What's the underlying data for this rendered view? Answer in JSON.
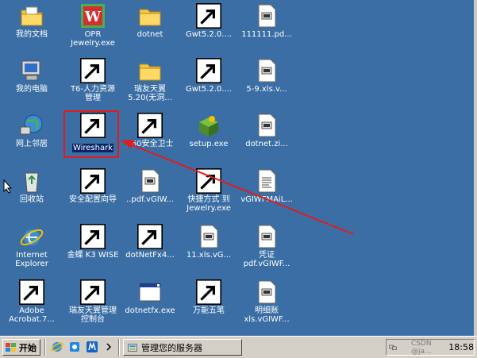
{
  "desktop": {
    "icons": [
      {
        "label": "我的文档",
        "icon": "my-documents-icon"
      },
      {
        "label": "OPR\nJewelry.exe",
        "icon": "wps-app-icon"
      },
      {
        "label": "dotnet",
        "icon": "folder-icon"
      },
      {
        "label": "Gwt5.2.0....",
        "icon": "installer-icon"
      },
      {
        "label": "111111.pd...",
        "icon": "document-icon"
      },
      {
        "label": "我的电脑",
        "icon": "my-computer-icon"
      },
      {
        "label": "T6-人力资源\n管理",
        "icon": "hr-app-icon"
      },
      {
        "label": "瑞友天翼\n5.20(无洞...",
        "icon": "folder-icon"
      },
      {
        "label": "Gwt5.2.0....",
        "icon": "installer-icon"
      },
      {
        "label": "5-9.xls.v...",
        "icon": "document-icon"
      },
      {
        "label": "网上邻居",
        "icon": "network-places-icon"
      },
      {
        "label": "Wireshark",
        "icon": "wireshark-shark-fin-icon"
      },
      {
        "label": "360安全卫士",
        "icon": "program-window-icon"
      },
      {
        "label": "setup.exe",
        "icon": "setup-box-icon"
      },
      {
        "label": "dotnet.zi...",
        "icon": "document-icon"
      },
      {
        "label": "回收站",
        "icon": "recycle-bin-icon"
      },
      {
        "label": "安全配置向导",
        "icon": "security-wizard-icon"
      },
      {
        "label": "..pdf.vGIW...",
        "icon": "document-icon"
      },
      {
        "label": "快捷方式 到\nJewelry.exe",
        "icon": "wps-app-icon"
      },
      {
        "label": "vGIWFMAiL...",
        "icon": "text-file-icon"
      },
      {
        "label": "Internet\nExplorer",
        "icon": "internet-explorer-icon"
      },
      {
        "label": "金蝶 K3 WISE",
        "icon": "kingdee-k3-icon"
      },
      {
        "label": "dotNetFx4...",
        "icon": "installer-icon"
      },
      {
        "label": "11.xls.vG...",
        "icon": "document-icon"
      },
      {
        "label": "凭证\npdf.vGIWF...",
        "icon": "document-icon"
      },
      {
        "label": "Adobe\nAcrobat.7...",
        "icon": "adobe-acrobat-icon"
      },
      {
        "label": "瑞友天翼管理\n控制台",
        "icon": "purple-orb-icon"
      },
      {
        "label": "dotnetfx.exe",
        "icon": "program-window-icon"
      },
      {
        "label": "万能五笔",
        "icon": "wanneng-wubi-icon"
      },
      {
        "label": "明细账\nxls.vGIWF...",
        "icon": "document-icon"
      }
    ]
  },
  "taskbar": {
    "start_label": "开始",
    "task_label": "管理您的服务器",
    "tray_watermark": "CSDN @ja...",
    "clock": "18:58"
  },
  "colors": {
    "desktop_bg": "#3a6ea5",
    "highlight": "#e31b1b",
    "selection": "#0a246a"
  }
}
